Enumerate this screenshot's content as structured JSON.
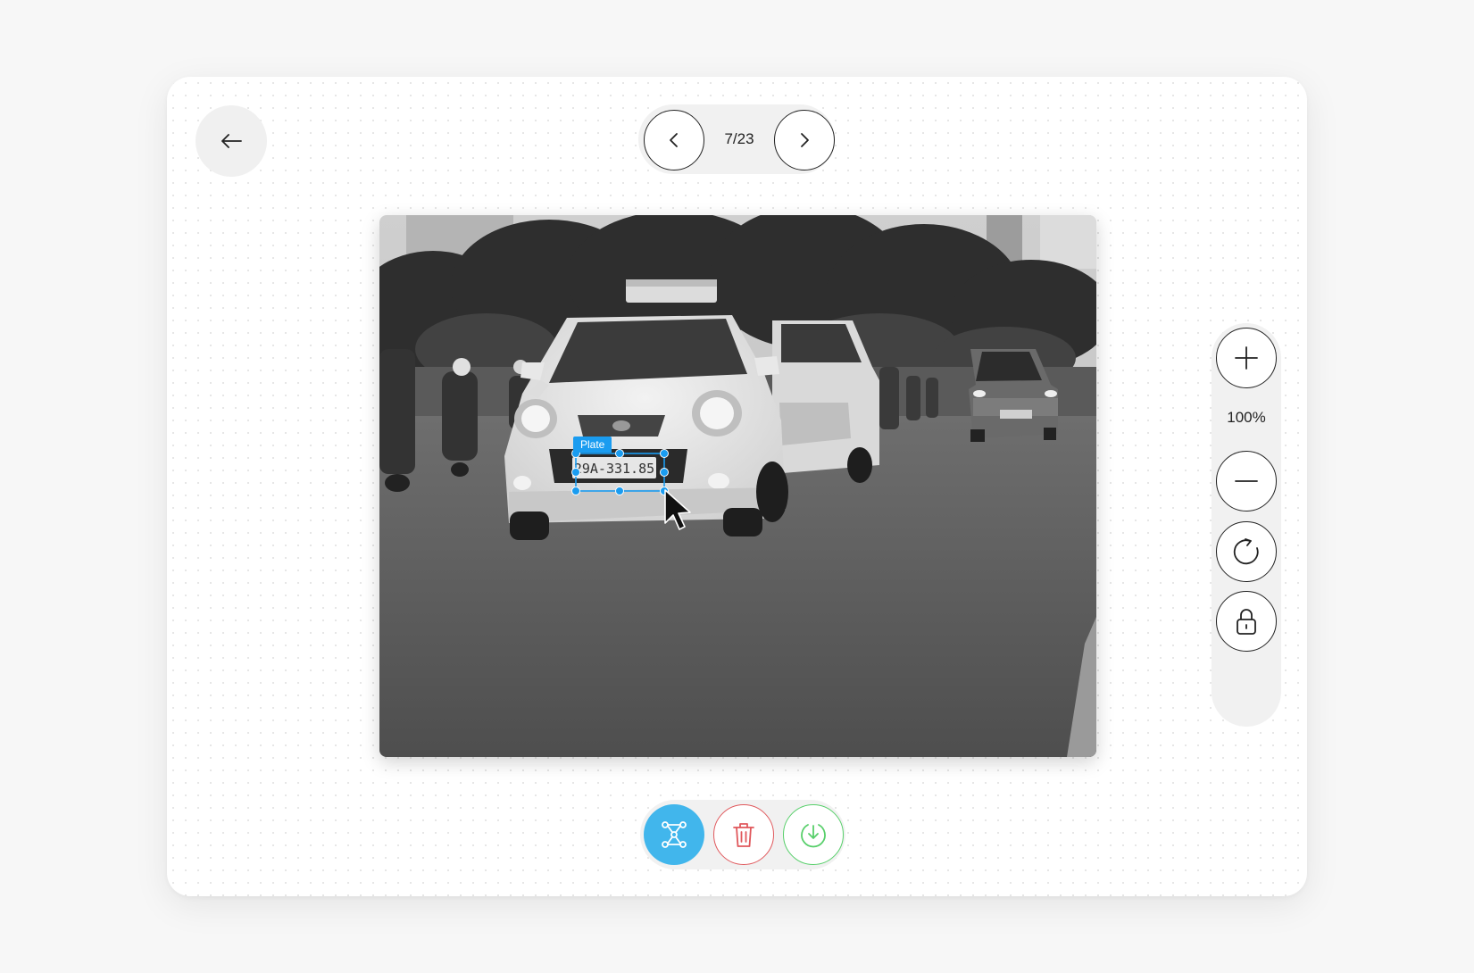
{
  "pager": {
    "current": 7,
    "total": 23,
    "label": "7/23"
  },
  "annotation": {
    "label": "Plate"
  },
  "zoom": {
    "level_label": "100%"
  },
  "icons": {
    "back": "arrow-left-icon",
    "prev": "chevron-left-icon",
    "next": "chevron-right-icon",
    "zoom_in": "plus-icon",
    "zoom_out": "minus-icon",
    "rotate": "rotate-icon",
    "lock": "lock-icon",
    "annotate": "polygon-nodes-icon",
    "delete": "trash-icon",
    "download": "download-icon"
  },
  "colors": {
    "annotation_accent": "#1a9cf0",
    "annotate_button": "#41b6ec",
    "delete_button": "#e0585c",
    "download_button": "#57cf6a"
  },
  "plate_text": "29A-331.85"
}
